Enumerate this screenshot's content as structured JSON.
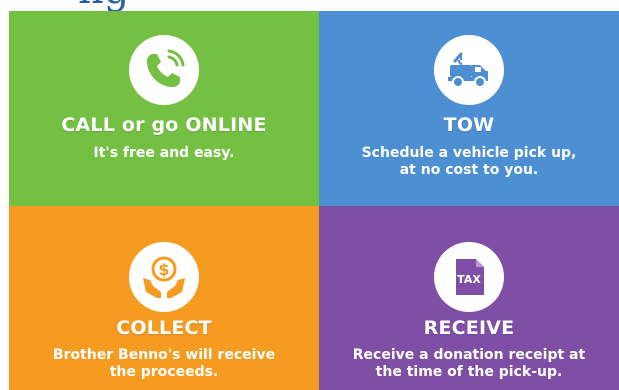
{
  "colors": {
    "green": "#74c043",
    "blue": "#4c8fd2",
    "orange": "#f59b1f",
    "purple": "#7f4fa6",
    "tile_text": "#ffffff",
    "header_text": "#2a5fa6"
  },
  "top_cut_heading": "ng",
  "tiles": [
    {
      "icon": "phone-icon",
      "heading": "CALL or go ONLINE",
      "lines": [
        "It's free and easy."
      ]
    },
    {
      "icon": "tow-truck-icon",
      "heading": "TOW",
      "lines": [
        "Schedule a vehicle pick up,",
        "at no cost to you."
      ]
    },
    {
      "icon": "money-hands-icon",
      "heading": "COLLECT",
      "lines": [
        "Brother Benno's will receive",
        "the proceeds."
      ]
    },
    {
      "icon": "tax-receipt-icon",
      "heading": "RECEIVE",
      "lines": [
        "Receive a donation receipt at",
        "the time of the pick-up."
      ]
    }
  ]
}
